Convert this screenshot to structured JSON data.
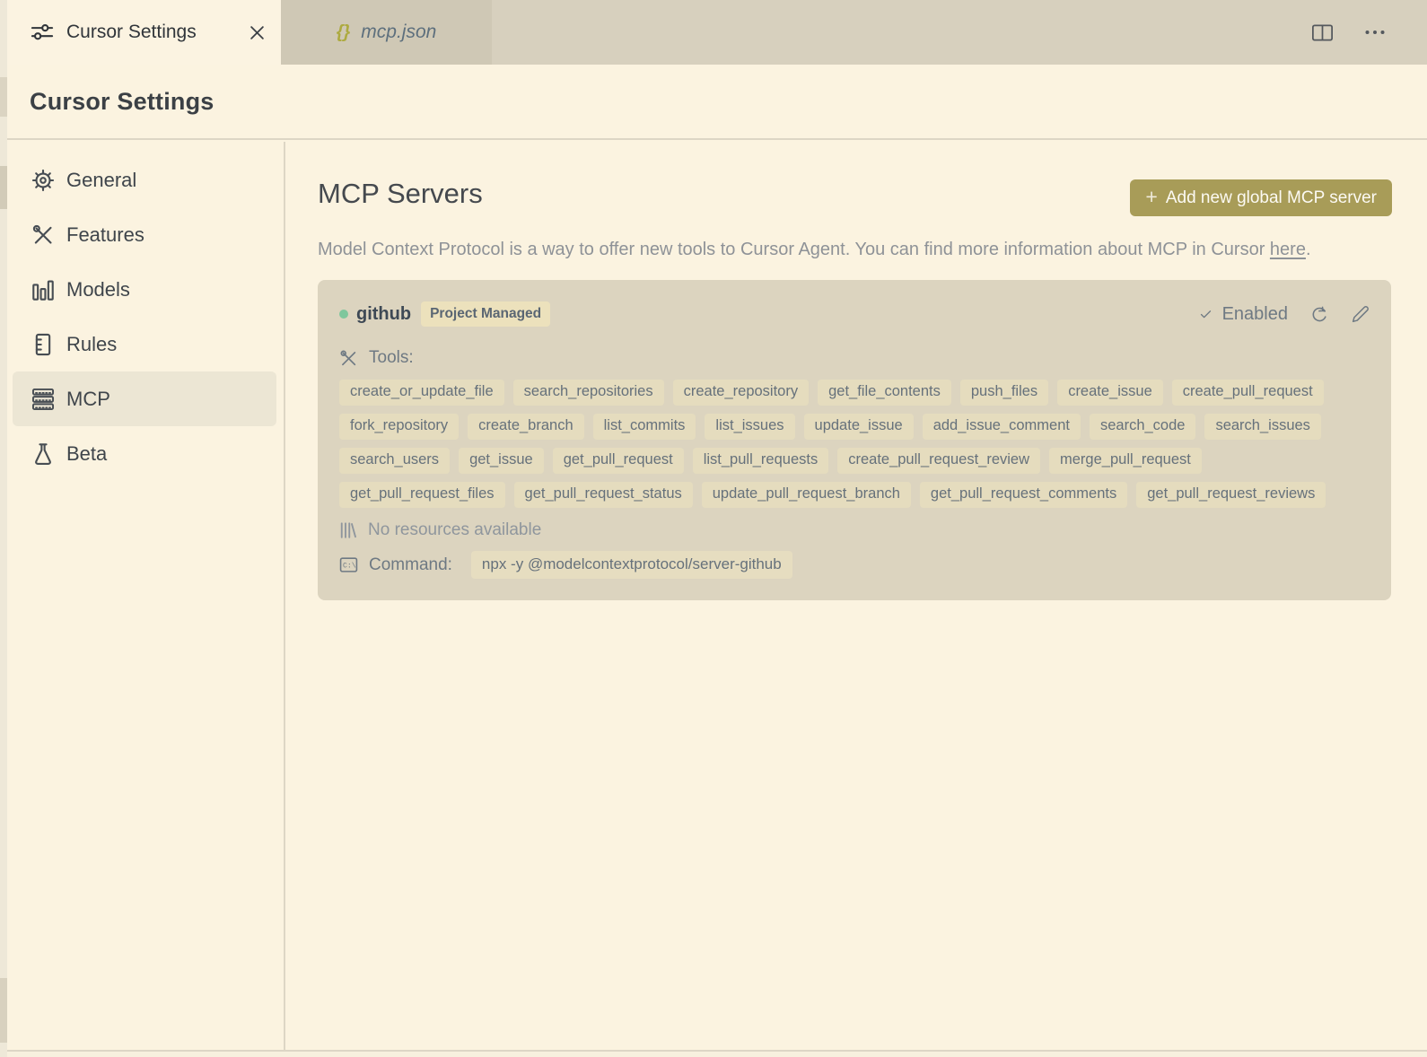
{
  "tabs": [
    {
      "label": "Cursor Settings",
      "icon": "sliders-icon",
      "active": true
    },
    {
      "label": "mcp.json",
      "icon": "braces-icon",
      "braces": "{}",
      "active": false,
      "preview": true
    }
  ],
  "page": {
    "title": "Cursor Settings"
  },
  "sidebar": {
    "items": [
      {
        "label": "General",
        "icon": "gear-icon",
        "selected": false
      },
      {
        "label": "Features",
        "icon": "tools-icon",
        "selected": false
      },
      {
        "label": "Models",
        "icon": "bar-chart-icon",
        "selected": false
      },
      {
        "label": "Rules",
        "icon": "ruler-icon",
        "selected": false
      },
      {
        "label": "MCP",
        "icon": "server-stack-icon",
        "selected": true
      },
      {
        "label": "Beta",
        "icon": "flask-icon",
        "selected": false
      }
    ]
  },
  "main": {
    "title": "MCP Servers",
    "add_button_plus": "+",
    "add_button_label": "Add new global MCP server",
    "description_before_link": "Model Context Protocol is a way to offer new tools to Cursor Agent. You can find more information about MCP in Cursor ",
    "description_link": "here",
    "description_after_link": "."
  },
  "server": {
    "name": "github",
    "badge": "Project Managed",
    "status_label": "Enabled",
    "tools_label": "Tools:",
    "tools": [
      "create_or_update_file",
      "search_repositories",
      "create_repository",
      "get_file_contents",
      "push_files",
      "create_issue",
      "create_pull_request",
      "fork_repository",
      "create_branch",
      "list_commits",
      "list_issues",
      "update_issue",
      "add_issue_comment",
      "search_code",
      "search_issues",
      "search_users",
      "get_issue",
      "get_pull_request",
      "list_pull_requests",
      "create_pull_request_review",
      "merge_pull_request",
      "get_pull_request_files",
      "get_pull_request_status",
      "update_pull_request_branch",
      "get_pull_request_comments",
      "get_pull_request_reviews"
    ],
    "resources_text": "No resources available",
    "command_label": "Command:",
    "command": "npx -y @modelcontextprotocol/server-github"
  },
  "colors": {
    "background": "#fbf3e0",
    "tabbar": "#d7d0be",
    "preview_tab": "#cfc8b5",
    "card": "#dcd4bf",
    "chip": "#e5dcbe",
    "badge": "#ece1bc",
    "accent_button": "#a89c58",
    "status_green": "#7fc79d",
    "braces_olive": "#adaa3f",
    "text_dark": "#3b4045",
    "text_slate": "#6e7983",
    "text_muted": "#8e9297"
  }
}
